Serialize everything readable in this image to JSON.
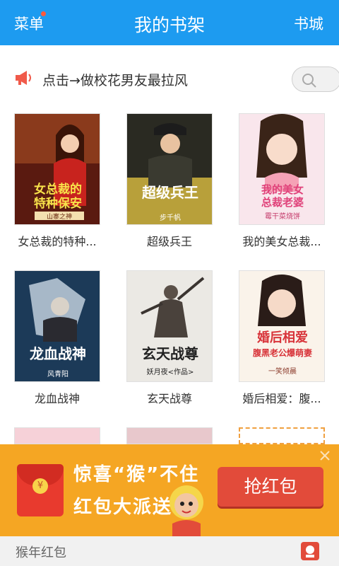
{
  "header": {
    "menu_label": "菜单",
    "title": "我的书架",
    "store_label": "书城"
  },
  "notice": {
    "text": "点击→做校花男友最拉风"
  },
  "books": [
    {
      "title": "女总裁的特种...",
      "cover_title": "女总裁的特种保安",
      "cover_author": "山寨之神"
    },
    {
      "title": "超级兵王",
      "cover_title": "超级兵王",
      "cover_author": "步千帆"
    },
    {
      "title": "我的美女总裁...",
      "cover_title": "我的美女总裁老婆",
      "cover_author": "霉干菜烧饼"
    },
    {
      "title": "龙血战神",
      "cover_title": "龙血战神",
      "cover_author": "风青阳"
    },
    {
      "title": "玄天战尊",
      "cover_title": "玄天战尊",
      "cover_author": "妖月夜<作品>"
    },
    {
      "title": "婚后相爱：腹...",
      "cover_title": "婚后相爱",
      "cover_subtitle": "腹黑老公爆萌妻",
      "cover_author": "一笑倾晨"
    }
  ],
  "promo": {
    "line1": "惊喜“猴”不住",
    "line2": "红包大派送",
    "grab_label": "抢红包",
    "coin_symbol": "¥"
  },
  "bottom": {
    "label": "猴年红包"
  },
  "colors": {
    "header_bg": "#1d9bf0",
    "promo_bg": "#f5a623",
    "grab_button": "#e24b3a"
  }
}
